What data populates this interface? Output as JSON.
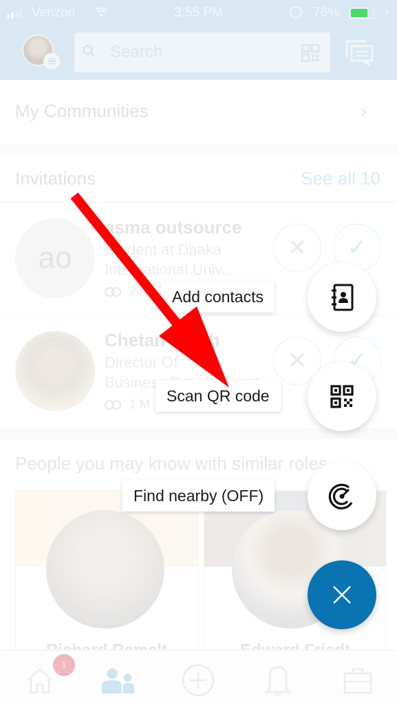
{
  "status_bar": {
    "carrier": "Verizon",
    "time": "3:55 PM",
    "battery_percent": "76%",
    "battery_level": 0.76,
    "signal_bars_filled": 2,
    "signal_bars_total": 4
  },
  "header": {
    "search_placeholder": "Search",
    "icons": [
      "avatar-menu",
      "search-icon",
      "qr-code-icon",
      "messaging-icon"
    ]
  },
  "my_communities": {
    "label": "My Communities"
  },
  "invitations": {
    "title": "Invitations",
    "see_all": "See all 10",
    "items": [
      {
        "initials": "ao",
        "name": "asma outsource",
        "headline_line1": "Student at Dhaka",
        "headline_line2": "International Univ...",
        "mutual": "20"
      },
      {
        "initials": "",
        "name": "Chetan Singh",
        "headline_line1": "Director Of",
        "headline_line2": "Business Development",
        "mutual": "1 M"
      }
    ]
  },
  "pymk": {
    "title": "People you may know with similar roles",
    "cards": [
      {
        "name": "Richard Ramelt"
      },
      {
        "name": "Edward Friedt"
      }
    ]
  },
  "tab_bar": {
    "tabs": [
      "home",
      "my-network",
      "post",
      "notifications",
      "jobs"
    ],
    "active": "my-network",
    "home_badge": "1"
  },
  "speed_dial": {
    "actions": [
      {
        "label": "Add contacts",
        "icon": "address-book-icon"
      },
      {
        "label": "Scan QR code",
        "icon": "qr-code-icon"
      },
      {
        "label": "Find nearby (OFF)",
        "icon": "radar-icon"
      }
    ],
    "close_icon": "close-icon"
  },
  "colors": {
    "brand_blue": "#0a73b1",
    "annotation_arrow": "#ff0000",
    "header_bg": "#d9e8f2",
    "battery_green": "#4cd964"
  }
}
